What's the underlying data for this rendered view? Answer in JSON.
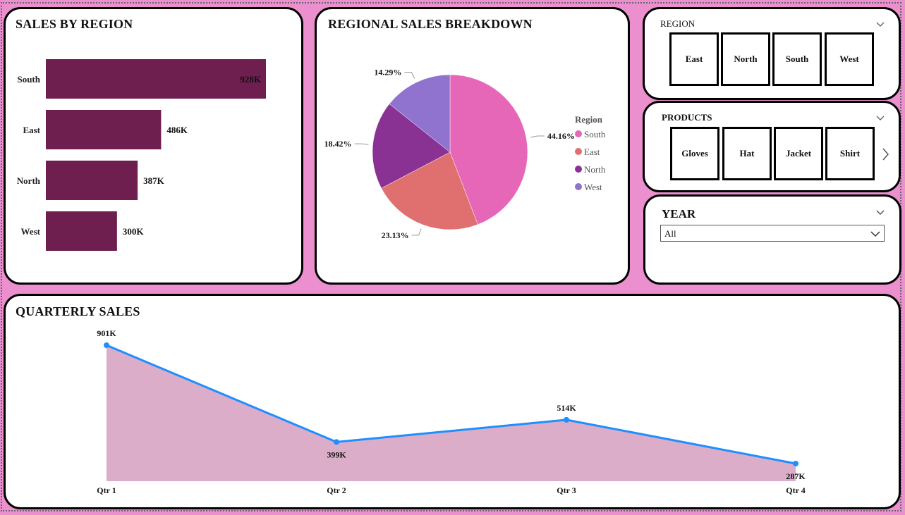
{
  "colors": {
    "background": "#eb8fcf",
    "bar": "#6e1f4f",
    "line": "#1e8fff",
    "area": "#dcadc9",
    "south": "#e667b8",
    "east": "#e0706f",
    "north": "#8a3294",
    "west": "#8f73cf"
  },
  "bar_panel": {
    "title": "SALES BY REGION"
  },
  "pie_panel": {
    "title": "REGIONAL SALES BREAKDOWN",
    "legend_title": "Region"
  },
  "line_panel": {
    "title": "QUARTERLY SALES"
  },
  "region_slicer": {
    "title": "REGION",
    "options": [
      "East",
      "North",
      "South",
      "West"
    ],
    "icon": "chevron-down-icon"
  },
  "products_slicer": {
    "title": "PRODUCTS",
    "options": [
      "Gloves",
      "Hat",
      "Jacket",
      "Shirt"
    ],
    "icons": [
      "chevron-down-icon",
      "chevron-right-icon"
    ]
  },
  "year_slicer": {
    "title": "YEAR",
    "selected": "All",
    "icons": [
      "chevron-down-icon"
    ]
  },
  "chart_data": [
    {
      "type": "bar",
      "orientation": "horizontal",
      "title": "SALES BY REGION",
      "categories": [
        "South",
        "East",
        "North",
        "West"
      ],
      "values": [
        928,
        486,
        387,
        300
      ],
      "labels": [
        "928K",
        "486K",
        "387K",
        "300K"
      ]
    },
    {
      "type": "pie",
      "title": "REGIONAL SALES BREAKDOWN",
      "legend_title": "Region",
      "legend_placement": "right",
      "categories": [
        "South",
        "East",
        "North",
        "West"
      ],
      "values": [
        44.16,
        23.13,
        18.42,
        14.29
      ],
      "labels": [
        "44.16%",
        "23.13%",
        "18.42%",
        "14.29%"
      ]
    },
    {
      "type": "area",
      "title": "QUARTERLY SALES",
      "categories": [
        "Qtr 1",
        "Qtr 2",
        "Qtr 3",
        "Qtr 4"
      ],
      "values": [
        901,
        399,
        514,
        287
      ],
      "labels": [
        "901K",
        "399K",
        "514K",
        "287K"
      ]
    }
  ]
}
